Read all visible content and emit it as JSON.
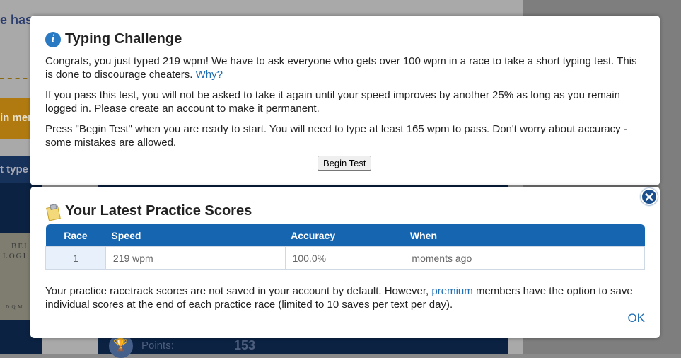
{
  "background": {
    "heading_fragment": "e has",
    "orange_fragment": "in mem",
    "nav_fragment": "t type",
    "book_line1": "BEI",
    "book_line2": "LOGI",
    "book_line3": "D. Q. M",
    "points_label": "Points:",
    "points_value": "153"
  },
  "typing_dialog": {
    "title": "Typing Challenge",
    "icon": "info-icon",
    "paragraph1": "Congrats, you just typed 219 wpm! We have to ask everyone who gets over 100 wpm in a race to take a short typing test. This is done to discourage cheaters.",
    "why_link": "Why?",
    "paragraph2": "If you pass this test, you will not be asked to take it again until your speed improves by another 25% as long as you remain logged in. Please create an account to make it permanent.",
    "paragraph3": "Press \"Begin Test\" when you are ready to start. You will need to type at least 165 wpm to pass. Don't worry about accuracy - some mistakes are allowed.",
    "begin_button": "Begin Test"
  },
  "scores_dialog": {
    "title": "Your Latest Practice Scores",
    "icon": "clipboard-icon",
    "close_icon": "close-icon",
    "columns": [
      "Race",
      "Speed",
      "Accuracy",
      "When"
    ],
    "rows": [
      {
        "race": "1",
        "speed": "219 wpm",
        "accuracy": "100.0%",
        "when": "moments ago"
      }
    ],
    "note_before": "Your practice racetrack scores are not saved in your account by default. However,",
    "premium_link": "premium",
    "note_after": "members have the option to save individual scores at the end of each practice race (limited to 10 saves per text per day).",
    "ok_link": "OK"
  },
  "colors": {
    "header_blue": "#1565b0",
    "link_blue": "#1f6db4",
    "close_button": "#1a4e8c"
  }
}
